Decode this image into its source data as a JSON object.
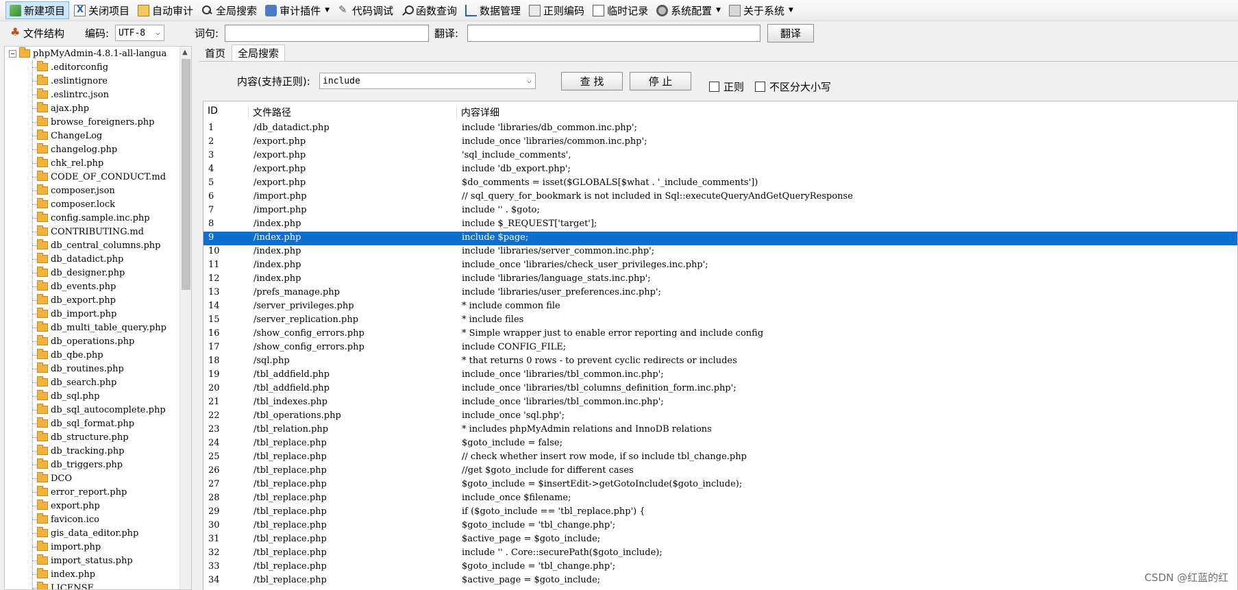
{
  "toolbar": {
    "items": [
      {
        "label": "新建项目",
        "icon": "new-project-icon",
        "dropdown": false
      },
      {
        "label": "关闭项目",
        "icon": "close-project-icon",
        "dropdown": false
      },
      {
        "label": "自动审计",
        "icon": "auto-audit-icon",
        "dropdown": false
      },
      {
        "label": "全局搜索",
        "icon": "global-search-icon",
        "dropdown": false
      },
      {
        "label": "审计插件",
        "icon": "plugin-icon",
        "dropdown": true
      },
      {
        "label": "代码调试",
        "icon": "code-debug-icon",
        "dropdown": false
      },
      {
        "label": "函数查询",
        "icon": "function-query-icon",
        "dropdown": false
      },
      {
        "label": "数据管理",
        "icon": "data-manage-icon",
        "dropdown": false
      },
      {
        "label": "正则编码",
        "icon": "regex-icon",
        "dropdown": false
      },
      {
        "label": "临时记录",
        "icon": "temp-record-icon",
        "dropdown": false
      },
      {
        "label": "系统配置",
        "icon": "config-icon",
        "dropdown": true
      },
      {
        "label": "关于系统",
        "icon": "about-icon",
        "dropdown": true
      }
    ]
  },
  "bar2": {
    "file_structure_label": "文件结构",
    "encoding_label": "编码:",
    "encoding_value": "UTF-8",
    "word_label": "词句:",
    "word_value": "",
    "translate_label": "翻译:",
    "translate_value": "",
    "translate_button": "翻译"
  },
  "tree": {
    "root": "phpMyAdmin-4.8.1-all-langua",
    "items": [
      ".editorconfig",
      ".eslintignore",
      ".eslintrc.json",
      "ajax.php",
      "browse_foreigners.php",
      "ChangeLog",
      "changelog.php",
      "chk_rel.php",
      "CODE_OF_CONDUCT.md",
      "composer.json",
      "composer.lock",
      "config.sample.inc.php",
      "CONTRIBUTING.md",
      "db_central_columns.php",
      "db_datadict.php",
      "db_designer.php",
      "db_events.php",
      "db_export.php",
      "db_import.php",
      "db_multi_table_query.php",
      "db_operations.php",
      "db_qbe.php",
      "db_routines.php",
      "db_search.php",
      "db_sql.php",
      "db_sql_autocomplete.php",
      "db_sql_format.php",
      "db_structure.php",
      "db_tracking.php",
      "db_triggers.php",
      "DCO",
      "error_report.php",
      "export.php",
      "favicon.ico",
      "gis_data_editor.php",
      "import.php",
      "import_status.php",
      "index.php",
      "LICENSE"
    ]
  },
  "tabs": [
    {
      "label": "首页",
      "active": false
    },
    {
      "label": "全局搜索",
      "active": true
    }
  ],
  "search": {
    "content_label": "内容(支持正则):",
    "content_value": "include",
    "find_button": "查 找",
    "stop_button": "停 止",
    "regex_label": "正则",
    "regex_checked": false,
    "case_label": "不区分大小写",
    "case_checked": false
  },
  "results": {
    "columns": [
      "ID",
      "文件路径",
      "内容详细"
    ],
    "selected_id": "9",
    "rows": [
      {
        "id": "1",
        "path": "/db_datadict.php",
        "detail": "include 'libraries/db_common.inc.php';"
      },
      {
        "id": "2",
        "path": "/export.php",
        "detail": "include_once 'libraries/common.inc.php';"
      },
      {
        "id": "3",
        "path": "/export.php",
        "detail": "'sql_include_comments',"
      },
      {
        "id": "4",
        "path": "/export.php",
        "detail": "include 'db_export.php';"
      },
      {
        "id": "5",
        "path": "/export.php",
        "detail": "$do_comments = isset($GLOBALS[$what . '_include_comments'])"
      },
      {
        "id": "6",
        "path": "/import.php",
        "detail": "// sql_query_for_bookmark is not included in Sql::executeQueryAndGetQueryResponse"
      },
      {
        "id": "7",
        "path": "/import.php",
        "detail": "include '' . $goto;"
      },
      {
        "id": "8",
        "path": "/index.php",
        "detail": "include $_REQUEST['target'];"
      },
      {
        "id": "9",
        "path": "/index.php",
        "detail": "include $page;"
      },
      {
        "id": "10",
        "path": "/index.php",
        "detail": "include 'libraries/server_common.inc.php';"
      },
      {
        "id": "11",
        "path": "/index.php",
        "detail": "include_once 'libraries/check_user_privileges.inc.php';"
      },
      {
        "id": "12",
        "path": "/index.php",
        "detail": "include 'libraries/language_stats.inc.php';"
      },
      {
        "id": "13",
        "path": "/prefs_manage.php",
        "detail": "include 'libraries/user_preferences.inc.php';"
      },
      {
        "id": "14",
        "path": "/server_privileges.php",
        "detail": "* include common file"
      },
      {
        "id": "15",
        "path": "/server_replication.php",
        "detail": "* include files"
      },
      {
        "id": "16",
        "path": "/show_config_errors.php",
        "detail": "* Simple wrapper just to enable error reporting and include config"
      },
      {
        "id": "17",
        "path": "/show_config_errors.php",
        "detail": "include CONFIG_FILE;"
      },
      {
        "id": "18",
        "path": "/sql.php",
        "detail": "*          that returns 0 rows - to prevent cyclic redirects or includes"
      },
      {
        "id": "19",
        "path": "/tbl_addfield.php",
        "detail": "include_once 'libraries/tbl_common.inc.php';"
      },
      {
        "id": "20",
        "path": "/tbl_addfield.php",
        "detail": "include_once 'libraries/tbl_columns_definition_form.inc.php';"
      },
      {
        "id": "21",
        "path": "/tbl_indexes.php",
        "detail": "include_once 'libraries/tbl_common.inc.php';"
      },
      {
        "id": "22",
        "path": "/tbl_operations.php",
        "detail": "include_once 'sql.php';"
      },
      {
        "id": "23",
        "path": "/tbl_relation.php",
        "detail": "* includes phpMyAdmin relations and InnoDB relations"
      },
      {
        "id": "24",
        "path": "/tbl_replace.php",
        "detail": "$goto_include = false;"
      },
      {
        "id": "25",
        "path": "/tbl_replace.php",
        "detail": "// check whether insert row mode, if so include tbl_change.php"
      },
      {
        "id": "26",
        "path": "/tbl_replace.php",
        "detail": "//get $goto_include for different cases"
      },
      {
        "id": "27",
        "path": "/tbl_replace.php",
        "detail": "$goto_include = $insertEdit->getGotoInclude($goto_include);"
      },
      {
        "id": "28",
        "path": "/tbl_replace.php",
        "detail": "include_once $filename;"
      },
      {
        "id": "29",
        "path": "/tbl_replace.php",
        "detail": "if ($goto_include == 'tbl_replace.php') {"
      },
      {
        "id": "30",
        "path": "/tbl_replace.php",
        "detail": "$goto_include = 'tbl_change.php';"
      },
      {
        "id": "31",
        "path": "/tbl_replace.php",
        "detail": "$active_page = $goto_include;"
      },
      {
        "id": "32",
        "path": "/tbl_replace.php",
        "detail": "include '' . Core::securePath($goto_include);"
      },
      {
        "id": "33",
        "path": "/tbl_replace.php",
        "detail": "$goto_include = 'tbl_change.php';"
      },
      {
        "id": "34",
        "path": "/tbl_replace.php",
        "detail": "$active_page = $goto_include;"
      }
    ]
  },
  "watermark": "CSDN @红蓝的红",
  "colors": {
    "selection": "#0a6fd0",
    "active_toolbar": "#cfe6fb"
  }
}
